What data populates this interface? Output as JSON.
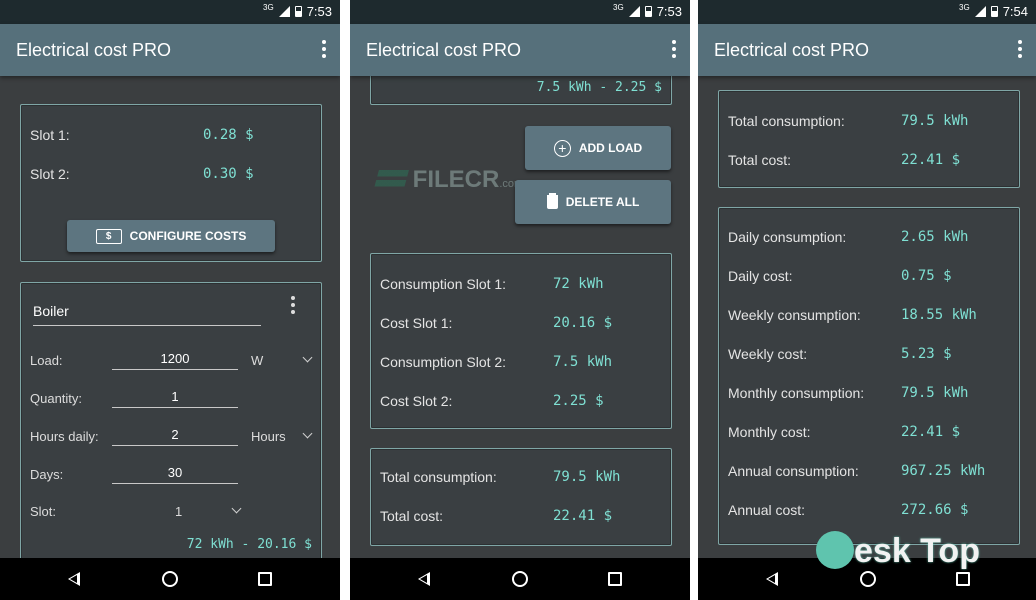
{
  "status": {
    "network": "3G",
    "times": [
      "7:53",
      "7:53",
      "7:54"
    ]
  },
  "app_title": "Electrical cost PRO",
  "screen1": {
    "slots": [
      {
        "label": "Slot 1:",
        "value": "0.28 $"
      },
      {
        "label": "Slot 2:",
        "value": "0.30 $"
      }
    ],
    "configure_button": "CONFIGURE COSTS",
    "appliance": {
      "name": "Boiler",
      "load_label": "Load:",
      "load_value": "1200",
      "load_unit": "W",
      "quantity_label": "Quantity:",
      "quantity_value": "1",
      "hours_label": "Hours daily:",
      "hours_value": "2",
      "hours_unit": "Hours",
      "days_label": "Days:",
      "days_value": "30",
      "slot_label": "Slot:",
      "slot_value": "1",
      "result": "72 kWh - 20.16 $"
    }
  },
  "screen2": {
    "top_result": "7.5 kWh - 2.25 $",
    "add_button": "ADD LOAD",
    "delete_button": "DELETE ALL",
    "slot_summary": [
      {
        "label": "Consumption Slot 1:",
        "value": "72 kWh"
      },
      {
        "label": "Cost Slot 1:",
        "value": "20.16 $"
      },
      {
        "label": "Consumption Slot 2:",
        "value": "7.5 kWh"
      },
      {
        "label": "Cost Slot 2:",
        "value": "2.25 $"
      }
    ],
    "totals": [
      {
        "label": "Total consumption:",
        "value": "79.5 kWh"
      },
      {
        "label": "Total cost:",
        "value": "22.41 $"
      }
    ]
  },
  "screen3": {
    "totals": [
      {
        "label": "Total consumption:",
        "value": "79.5 kWh"
      },
      {
        "label": "Total cost:",
        "value": "22.41 $"
      }
    ],
    "periods": [
      {
        "label": "Daily consumption:",
        "value": "2.65 kWh"
      },
      {
        "label": "Daily cost:",
        "value": "0.75 $"
      },
      {
        "label": "Weekly consumption:",
        "value": "18.55 kWh"
      },
      {
        "label": "Weekly cost:",
        "value": "5.23 $"
      },
      {
        "label": "Monthly consumption:",
        "value": "79.5 kWh"
      },
      {
        "label": "Monthly cost:",
        "value": "22.41 $"
      },
      {
        "label": "Annual consumption:",
        "value": "967.25 kWh"
      },
      {
        "label": "Annual cost:",
        "value": "272.66 $"
      }
    ]
  },
  "watermarks": {
    "filecr": "FILECR",
    "filecr_sub": ".com",
    "desktop": "esk Top"
  },
  "colors": {
    "appbar": "#56707b",
    "background": "#3b3e40",
    "value_text": "#7fe0d3",
    "card_border": "#7fa6a6",
    "button": "#5d7580"
  }
}
